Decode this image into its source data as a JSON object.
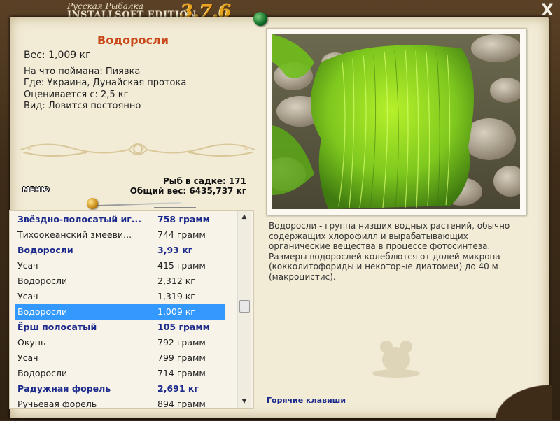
{
  "app": {
    "title_line1": "Русская Рыбалка",
    "title_line2": "INSTALLSOFT EDITION",
    "version": "3.7.6",
    "close_label": "X"
  },
  "fish": {
    "name": "Водоросли",
    "weight": "Вес: 1,009 кг",
    "caught_on": "На что поймана: Пиявка",
    "where": "Где: Украина, Дунайская протока",
    "valued_from": "Оценивается с: 2,5 кг",
    "type": "Вид: Ловится постоянно"
  },
  "summary": {
    "in_keepnet": "Рыб в садке: 171",
    "total_weight": "Общий вес: 6435,737 кг"
  },
  "menu_label": "МЕНЮ",
  "catch_list": [
    {
      "name": "Звёздно-полосатый иг...",
      "weight": "758 грамм",
      "style": "bold"
    },
    {
      "name": "Тихоокеанский змееви...",
      "weight": "744 грамм",
      "style": "normal"
    },
    {
      "name": "Водоросли",
      "weight": "3,93 кг",
      "style": "bold"
    },
    {
      "name": "Усач",
      "weight": "415 грамм",
      "style": "normal"
    },
    {
      "name": "Водоросли",
      "weight": "2,312 кг",
      "style": "normal"
    },
    {
      "name": "Усач",
      "weight": "1,319 кг",
      "style": "normal"
    },
    {
      "name": "Водоросли",
      "weight": "1,009 кг",
      "style": "selected"
    },
    {
      "name": "Ёрш полосатый",
      "weight": "105 грамм",
      "style": "bold"
    },
    {
      "name": "Окунь",
      "weight": "792 грамм",
      "style": "normal"
    },
    {
      "name": "Усач",
      "weight": "799 грамм",
      "style": "normal"
    },
    {
      "name": "Водоросли",
      "weight": "714 грамм",
      "style": "normal"
    },
    {
      "name": "Радужная форель",
      "weight": "2,691 кг",
      "style": "bold"
    },
    {
      "name": "Ручьевая форель",
      "weight": "894 грамм",
      "style": "normal"
    }
  ],
  "description": "Водоросли - группа низших водных растений, обычно содержащих хлорофилл и вырабатывающих органические вещества в процессе фотосинтеза. Размеры водорослей колеблются от долей микрона (кокколитофориды и некоторые диатомеи) до 40 м (макроцистис).",
  "hotkeys_label": "Горячие клавиши",
  "icons": {
    "close": "close-icon",
    "scroll_up": "arrow-up-icon",
    "scroll_down": "arrow-down-icon",
    "pin": "pin-icon",
    "stamp": "mouse-stamp-icon"
  },
  "colors": {
    "fish_title": "#c8481a",
    "bold_row": "#1c2a8c",
    "selected_row": "#3399ff",
    "version": "#e8a420"
  }
}
